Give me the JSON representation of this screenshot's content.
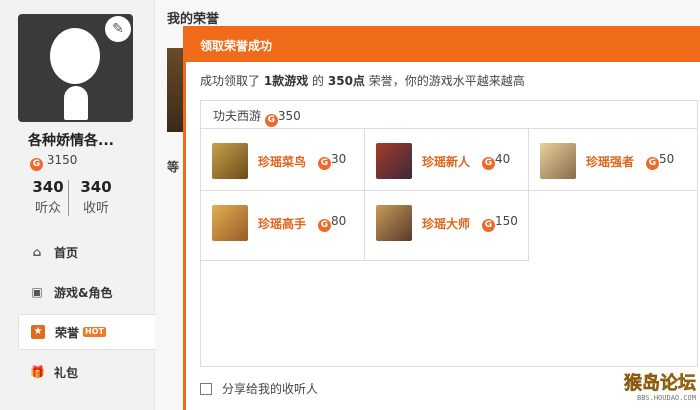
{
  "profile": {
    "name": "各种娇情各...",
    "coins": "3150",
    "listeners_count": "340",
    "listeners_label": "听众",
    "following_count": "340",
    "following_label": "收听"
  },
  "nav": [
    {
      "label": "首页",
      "icon": "home-icon"
    },
    {
      "label": "游戏&角色",
      "icon": "gamepad-icon"
    },
    {
      "label": "荣誉",
      "icon": "star-icon",
      "badge": "HOT",
      "active": true
    },
    {
      "label": "礼包",
      "icon": "gift-icon"
    }
  ],
  "main": {
    "title": "我的荣誉",
    "partial_text": "等"
  },
  "modal": {
    "header": "领取荣誉成功",
    "msg_prefix": "成功领取了",
    "msg_count": "1款游戏",
    "msg_mid": "的",
    "msg_points": "350点",
    "msg_suffix": "荣誉，你的游戏水平越来越高",
    "game_name": "功夫西游",
    "game_points": "350",
    "honors": [
      {
        "name": "珍瑶菜鸟",
        "points": "30"
      },
      {
        "name": "珍瑶新人",
        "points": "40"
      },
      {
        "name": "珍瑶强者",
        "points": "50"
      },
      {
        "name": "珍瑶高手",
        "points": "80"
      },
      {
        "name": "珍瑶大师",
        "points": "150"
      }
    ],
    "share_label": "分享给我的收听人"
  },
  "watermark": {
    "title": "猴岛论坛",
    "url": "BBS.HOUDAO.COM"
  },
  "colors": {
    "accent": "#f06b19",
    "honor_text": "#e0641c"
  }
}
